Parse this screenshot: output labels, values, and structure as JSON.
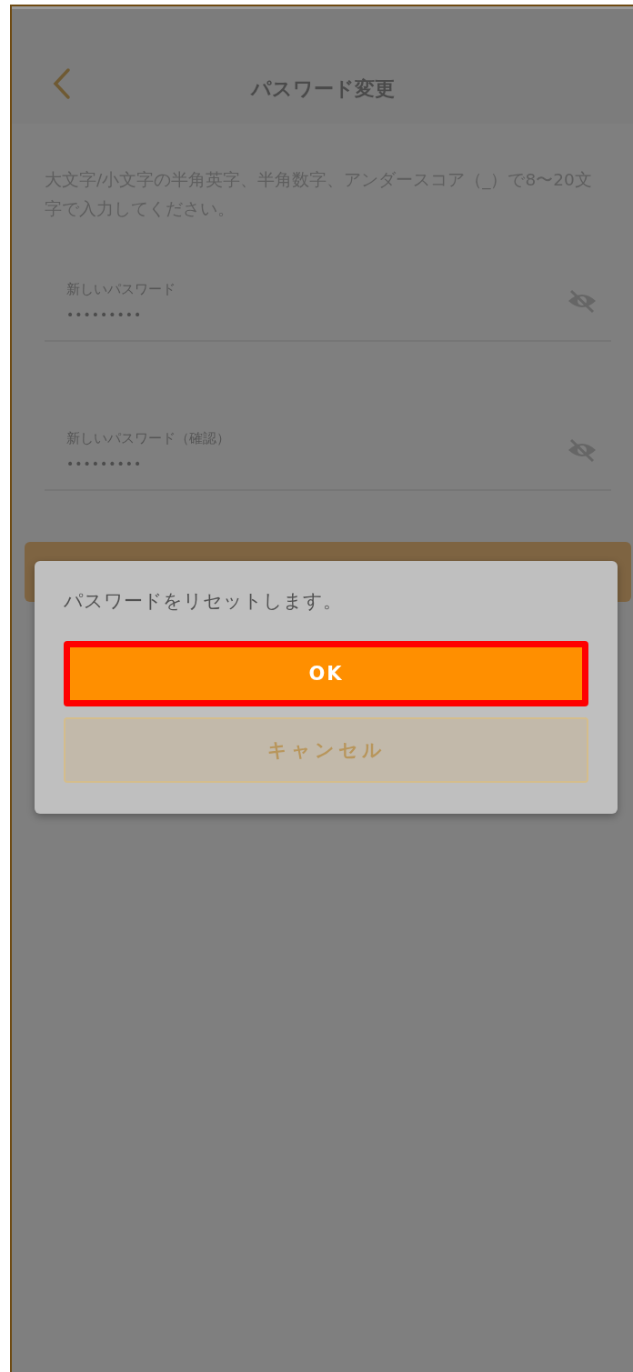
{
  "header": {
    "title": "パスワード変更"
  },
  "instructions": "大文字/小文字の半角英字、半角数字、アンダースコア（_）で8〜20文字で入力してください。",
  "fields": [
    {
      "label": "新しいパスワード",
      "value": "•••••••••",
      "password_visible": false
    },
    {
      "label": "新しいパスワード（確認）",
      "value": "•••••••••",
      "password_visible": false
    }
  ],
  "dialog": {
    "message": "パスワードをリセットします。",
    "buttons": [
      {
        "label": "OK",
        "kind": "primary",
        "highlighted": true
      },
      {
        "label": "キャンセル",
        "kind": "secondary",
        "highlighted": false
      }
    ]
  }
}
